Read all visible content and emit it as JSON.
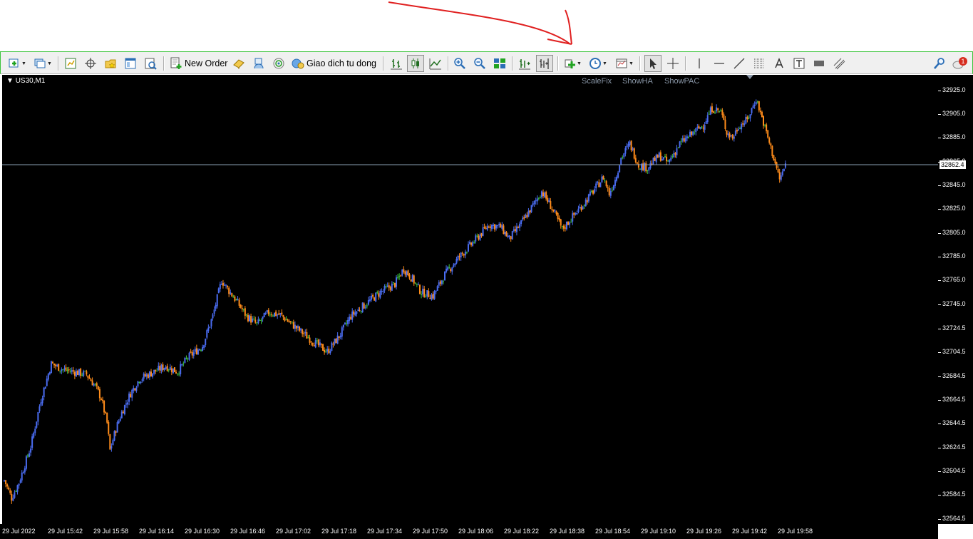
{
  "toolbar": {
    "new_order_label": "New Order",
    "auto_trading_label": "Giao dich tu dong",
    "notification_count": "1",
    "icons": [
      "new-chart-icon",
      "profiles-icon",
      "market-watch-icon",
      "navigator-icon",
      "data-window-icon",
      "terminal-icon",
      "strategy-tester-icon",
      "new-order-icon",
      "metaeditor-icon",
      "signals-icon",
      "auto-trading-icon",
      "bar-chart-icon",
      "candlestick-icon",
      "line-chart-icon",
      "zoom-in-icon",
      "zoom-out-icon",
      "tile-windows-icon",
      "chart-shift-icon",
      "autoscroll-icon",
      "indicators-icon",
      "periods-icon",
      "templates-icon",
      "cursor-icon",
      "crosshair-icon",
      "vertical-line-icon",
      "horizontal-line-icon",
      "trendline-icon",
      "fibonacci-icon",
      "text-icon",
      "text-label-icon",
      "rectangle-icon",
      "equidistant-channel-icon",
      "search-icon",
      "notification-icon"
    ]
  },
  "chart": {
    "symbol": "US30,M1",
    "buttons": {
      "scale_fix": "ScaleFix",
      "show_ha": "ShowHA",
      "show_pac": "ShowPAC"
    },
    "current_price": "32862.4",
    "colors": {
      "background": "#000000",
      "bull": "#4a6cf0",
      "bear": "#ff8c1a",
      "doji": "#3fc43f",
      "bid_line": "#8aa0b4"
    }
  },
  "chart_data": {
    "type": "candlestick",
    "symbol": "US30",
    "timeframe": "M1",
    "current_price": 32862.4,
    "y_ticks": [
      32925.0,
      32905.0,
      32885.0,
      32865.0,
      32845.0,
      32825.0,
      32805.0,
      32785.0,
      32765.0,
      32745.0,
      32724.5,
      32704.5,
      32684.5,
      32664.5,
      32644.5,
      32624.5,
      32604.5,
      32584.5,
      32564.5
    ],
    "x_ticks": [
      "29 Jul 2022",
      "29 Jul 15:42",
      "29 Jul 15:58",
      "29 Jul 16:14",
      "29 Jul 16:30",
      "29 Jul 16:46",
      "29 Jul 17:02",
      "29 Jul 17:18",
      "29 Jul 17:34",
      "29 Jul 17:50",
      "29 Jul 18:06",
      "29 Jul 18:22",
      "29 Jul 18:38",
      "29 Jul 18:54",
      "29 Jul 19:10",
      "29 Jul 19:26",
      "29 Jul 19:42",
      "29 Jul 19:58"
    ],
    "ylim": [
      32560,
      32938
    ],
    "close_path": [
      [
        0,
        32597
      ],
      [
        5,
        32582
      ],
      [
        10,
        32595
      ],
      [
        18,
        32625
      ],
      [
        25,
        32665
      ],
      [
        32,
        32695
      ],
      [
        40,
        32690
      ],
      [
        48,
        32688
      ],
      [
        56,
        32686
      ],
      [
        62,
        32676
      ],
      [
        66,
        32666
      ],
      [
        70,
        32645
      ],
      [
        72,
        32622
      ],
      [
        76,
        32640
      ],
      [
        80,
        32654
      ],
      [
        86,
        32670
      ],
      [
        92,
        32682
      ],
      [
        100,
        32687
      ],
      [
        110,
        32693
      ],
      [
        118,
        32688
      ],
      [
        125,
        32700
      ],
      [
        135,
        32710
      ],
      [
        142,
        32735
      ],
      [
        148,
        32765
      ],
      [
        152,
        32758
      ],
      [
        158,
        32748
      ],
      [
        165,
        32735
      ],
      [
        172,
        32728
      ],
      [
        180,
        32738
      ],
      [
        188,
        32736
      ],
      [
        196,
        32728
      ],
      [
        204,
        32720
      ],
      [
        212,
        32712
      ],
      [
        220,
        32705
      ],
      [
        228,
        32718
      ],
      [
        236,
        32735
      ],
      [
        246,
        32745
      ],
      [
        256,
        32755
      ],
      [
        266,
        32762
      ],
      [
        272,
        32775
      ],
      [
        278,
        32766
      ],
      [
        284,
        32755
      ],
      [
        292,
        32752
      ],
      [
        300,
        32770
      ],
      [
        310,
        32785
      ],
      [
        320,
        32798
      ],
      [
        330,
        32812
      ],
      [
        338,
        32810
      ],
      [
        344,
        32800
      ],
      [
        352,
        32813
      ],
      [
        360,
        32828
      ],
      [
        366,
        32840
      ],
      [
        372,
        32828
      ],
      [
        376,
        32818
      ],
      [
        380,
        32808
      ],
      [
        388,
        32820
      ],
      [
        396,
        32832
      ],
      [
        404,
        32845
      ],
      [
        408,
        32852
      ],
      [
        412,
        32838
      ],
      [
        416,
        32850
      ],
      [
        420,
        32868
      ],
      [
        426,
        32880
      ],
      [
        432,
        32862
      ],
      [
        438,
        32860
      ],
      [
        446,
        32870
      ],
      [
        452,
        32864
      ],
      [
        460,
        32880
      ],
      [
        468,
        32888
      ],
      [
        476,
        32896
      ],
      [
        482,
        32910
      ],
      [
        488,
        32907
      ],
      [
        492,
        32890
      ],
      [
        496,
        32885
      ],
      [
        500,
        32895
      ],
      [
        506,
        32900
      ],
      [
        512,
        32918
      ],
      [
        516,
        32902
      ],
      [
        520,
        32885
      ],
      [
        524,
        32868
      ],
      [
        528,
        32850
      ],
      [
        532,
        32862
      ]
    ]
  }
}
